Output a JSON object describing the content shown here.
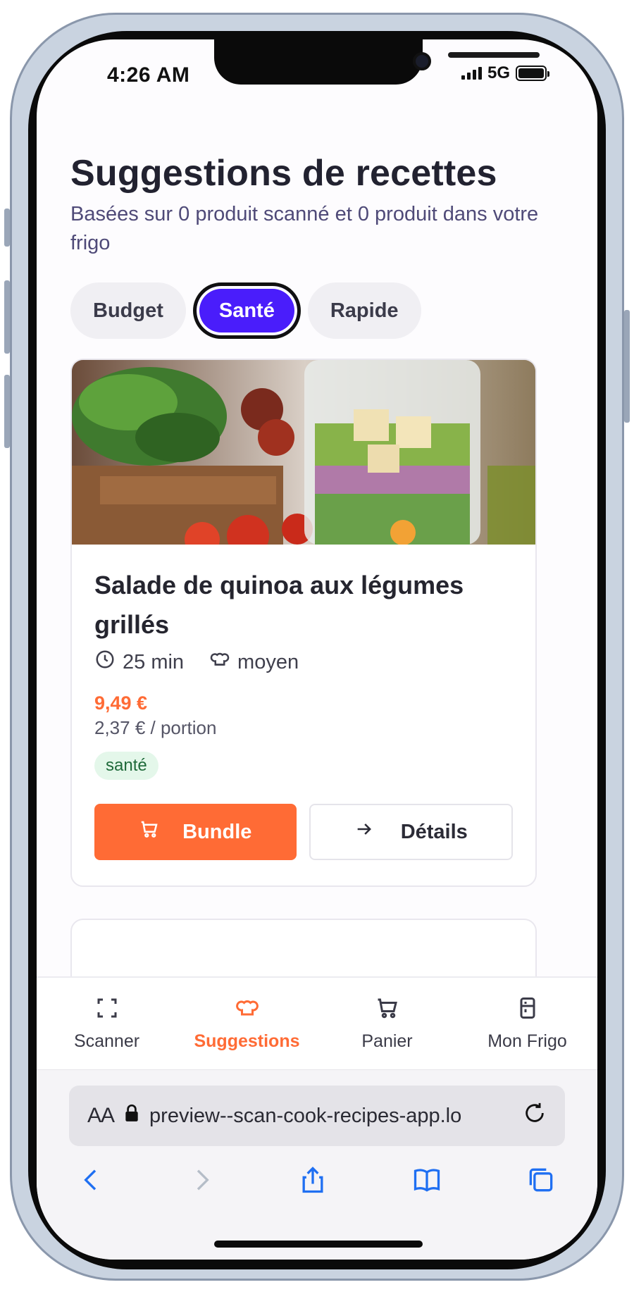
{
  "status": {
    "time": "4:26 AM",
    "network": "5G"
  },
  "header": {
    "title": "Suggestions de recettes",
    "subtitle": "Basées sur 0 produit scanné et 0 produit dans votre frigo"
  },
  "filters": [
    {
      "label": "Budget",
      "active": false
    },
    {
      "label": "Santé",
      "active": true
    },
    {
      "label": "Rapide",
      "active": false
    }
  ],
  "recipe": {
    "title": "Salade de quinoa aux légumes grillés",
    "time": "25 min",
    "difficulty": "moyen",
    "price": "9,49 €",
    "per_portion": "2,37 € / portion",
    "tag": "santé",
    "bundle_label": "Bundle",
    "details_label": "Détails"
  },
  "nav": {
    "items": [
      {
        "label": "Scanner",
        "icon": "scan-icon"
      },
      {
        "label": "Suggestions",
        "icon": "chef-hat-icon",
        "active": true
      },
      {
        "label": "Panier",
        "icon": "cart-icon"
      },
      {
        "label": "Mon Frigo",
        "icon": "fridge-icon"
      }
    ]
  },
  "browser": {
    "aa_label": "AA",
    "url": "preview--scan-cook-recipes-app.lo"
  },
  "colors": {
    "accent": "#ff6b35",
    "chip_active": "#4a1dfb",
    "text": "#222230"
  }
}
